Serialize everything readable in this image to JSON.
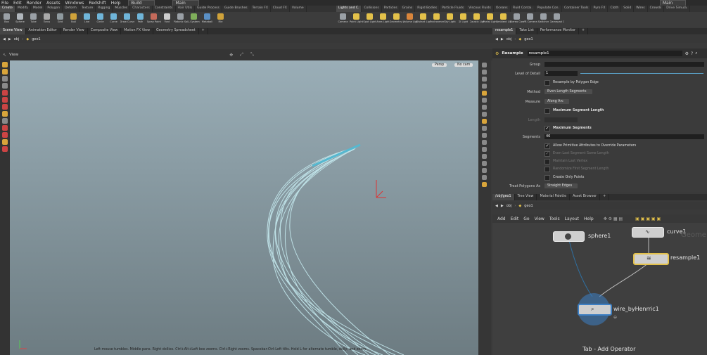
{
  "menubar": {
    "items": [
      "File",
      "Edit",
      "Render",
      "Assets",
      "Windows",
      "Redshift",
      "Help"
    ],
    "build_combo": "Build",
    "main_combo": "Main",
    "right_combo": "Main"
  },
  "shelf_tabs_left": [
    "Create",
    "Modify",
    "Model",
    "Polygon",
    "Deform",
    "Texture",
    "Rigging",
    "Muscles",
    "Characters",
    "Constraints",
    "Hair Utils",
    "Guide Process",
    "Guide Brushes",
    "Terrain FX",
    "Cloud FX",
    "Volume"
  ],
  "shelf_tabs_right": [
    "Lights and C.",
    "Collisions",
    "Particles",
    "Grains",
    "Rigid Bodies",
    "Particle Fluids",
    "Viscous Fluids",
    "Oceans",
    "Fluid Contai.",
    "Populate Con.",
    "Container Tools",
    "Pyro FX",
    "Cloth",
    "Solid",
    "Wires",
    "Crowds",
    "Drive Simula."
  ],
  "shelf_tools_left": [
    {
      "label": "Box",
      "color": "#9aa0a6"
    },
    {
      "label": "Sphere",
      "color": "#b0b6bc"
    },
    {
      "label": "Tube",
      "color": "#9aa0a6"
    },
    {
      "label": "Torus",
      "color": "#a8a8a8"
    },
    {
      "label": "Grid",
      "color": "#8f9a9f"
    },
    {
      "label": "Null",
      "color": "#cfa23a"
    },
    {
      "label": "Line",
      "color": "#6fb5d9"
    },
    {
      "label": "Circle",
      "color": "#6fb5d9"
    },
    {
      "label": "Curve",
      "color": "#6fb5d9"
    },
    {
      "label": "Draw Curve",
      "color": "#6fb5d9"
    },
    {
      "label": "Path",
      "color": "#6fb5d9"
    },
    {
      "label": "Spray Paint",
      "color": "#c46a5a"
    },
    {
      "label": "Font",
      "color": "#cccccc"
    },
    {
      "label": "Platonic Solids",
      "color": "#9aa0a6"
    },
    {
      "label": "L-System",
      "color": "#7fae5a"
    },
    {
      "label": "Metaball",
      "color": "#5a8fc4"
    },
    {
      "label": "File",
      "color": "#cfa23a"
    }
  ],
  "shelf_tools_right": [
    {
      "label": "Camera",
      "color": "#9aa0a6"
    },
    {
      "label": "Point Light",
      "color": "#e3c14a"
    },
    {
      "label": "Spot Light",
      "color": "#e3c14a"
    },
    {
      "label": "Area Light",
      "color": "#e3c14a"
    },
    {
      "label": "Geometry Light",
      "color": "#e3c14a"
    },
    {
      "label": "Volume Light",
      "color": "#d9853b"
    },
    {
      "label": "Distant Light",
      "color": "#e3c14a"
    },
    {
      "label": "Environment Light",
      "color": "#e3c14a"
    },
    {
      "label": "Sky Light",
      "color": "#e3c14a"
    },
    {
      "label": "GI Light",
      "color": "#e3c14a"
    },
    {
      "label": "Caustic Light",
      "color": "#e3c14a"
    },
    {
      "label": "Portal Light",
      "color": "#e3c14a"
    },
    {
      "label": "Ambient Light",
      "color": "#e3c14a"
    },
    {
      "label": "Stereo Camera",
      "color": "#9aa0a6"
    },
    {
      "label": "VR Camera",
      "color": "#9aa0a6"
    },
    {
      "label": "Switcher",
      "color": "#9aa0a6"
    },
    {
      "label": "Gamepad Camera",
      "color": "#9aa0a6"
    }
  ],
  "left_panel_tabs": [
    "Scene View",
    "Animation Editor",
    "Render View",
    "Composite View",
    "Motion FX View",
    "Geometry Spreadsheet"
  ],
  "left_path": {
    "obj": "obj",
    "geo": "geo1"
  },
  "viewport": {
    "title": "View",
    "persp": "Persp",
    "cam": "No cam",
    "hint": "Left mouse tumbles. Middle pans. Right dollies. Ctrl+Alt+Left box zooms. Ctrl+Right zooms. Spacebar-Ctrl-Left tilts. Hold L for alternate tumble, dolly, and zoom."
  },
  "param_tabs": [
    "resample1",
    "Take List",
    "Performance Monitor"
  ],
  "param_path": {
    "obj": "obj",
    "geo": "geo1"
  },
  "param_header": {
    "type": "Resample",
    "name": "resample1"
  },
  "params": {
    "group_label": "Group",
    "group_value": "",
    "lod_label": "Level of Detail",
    "lod_value": "1",
    "by_edge": "Resample by Polygon Edge",
    "method_label": "Method",
    "method_value": "Even Length Segments",
    "measure_label": "Measure",
    "measure_value": "Along Arc",
    "max_seg_len": "Maximum Segment Length",
    "length_label": "Length",
    "max_segs": "Maximum Segments",
    "segments_label": "Segments",
    "segments_value": "46",
    "allow_prim": "Allow Primitive Attributes to Override Parameters",
    "even_last": "Even Last Segment Same Length",
    "maintain": "Maintain Last Vertex",
    "randomize": "Randomize First Segment Length",
    "points_only": "Create Only Points",
    "treat_label": "Treat Polygons As",
    "treat_value": "Straight Edges"
  },
  "net_tabs": [
    "/obj/geo1",
    "Tree View",
    "Material Palette",
    "Asset Browser"
  ],
  "net_path": {
    "obj": "obj",
    "geo": "geo1"
  },
  "net_menu": [
    "Add",
    "Edit",
    "Go",
    "View",
    "Tools",
    "Layout",
    "Help"
  ],
  "nodes": {
    "sphere": "sphere1",
    "curve": "curve1",
    "resample": "resample1",
    "wire": "wire_byHenrric1",
    "geometry_watermark": "Geome"
  },
  "net_hint": "Tab - Add Operator"
}
